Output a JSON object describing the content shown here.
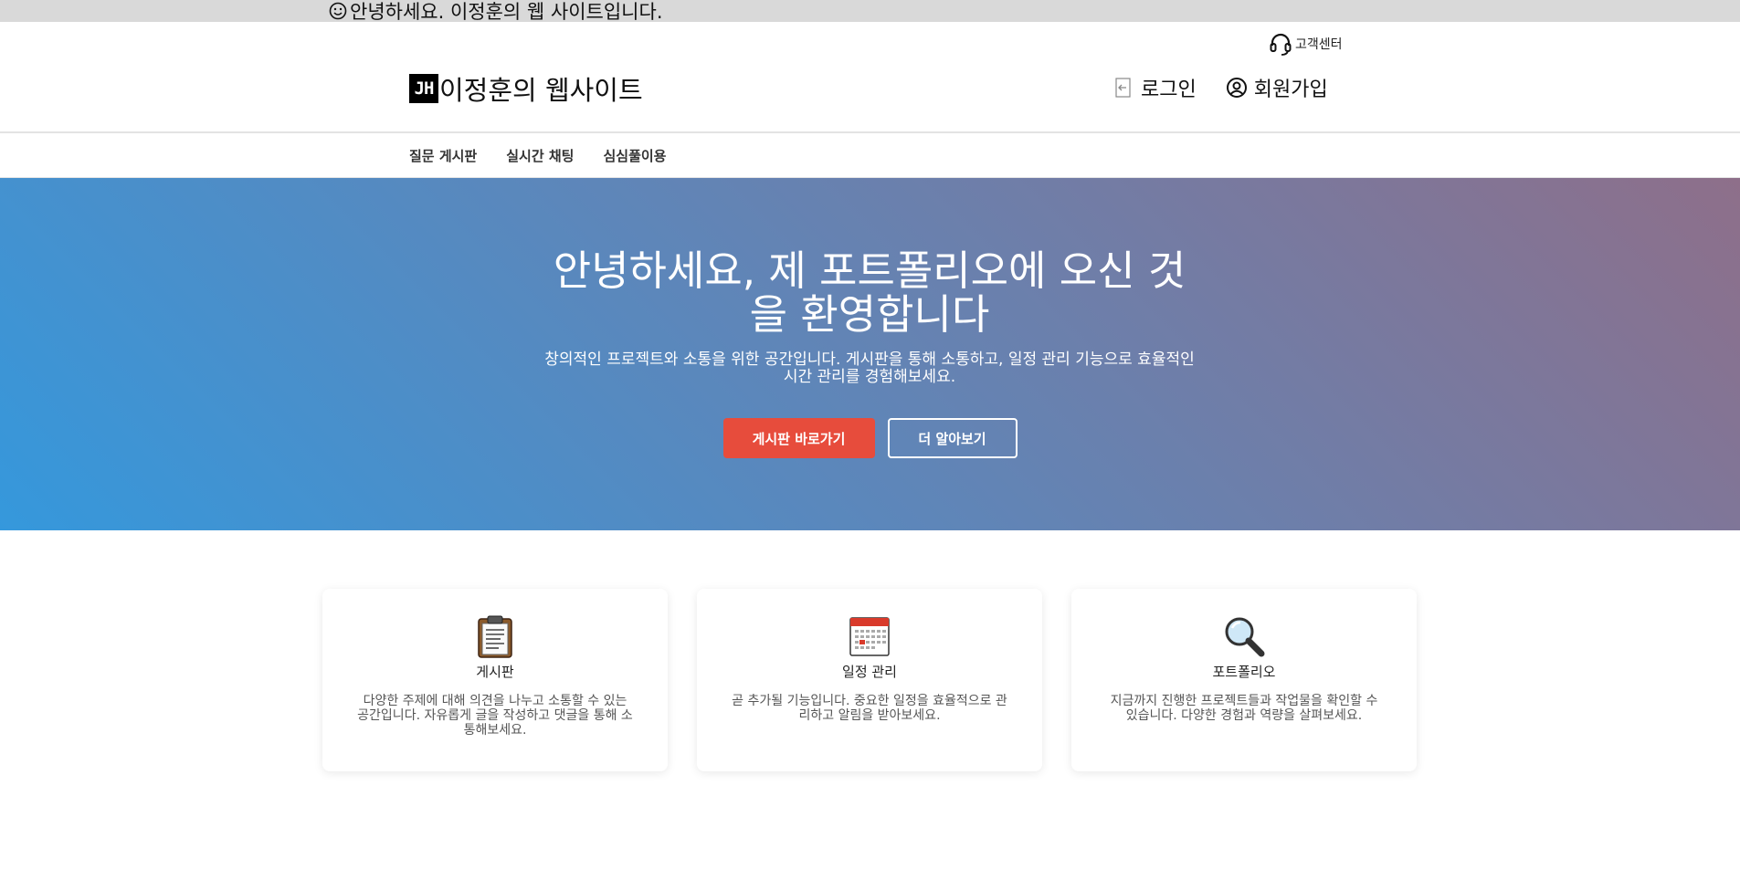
{
  "topbar": {
    "message": "안녕하세요. 이정훈의 웹 사이트입니다.",
    "icon": "smiley-icon"
  },
  "header": {
    "help_label": "고객센터",
    "logo_mark": "JH",
    "logo_text": "이정훈의 웹사이트",
    "login_label": "로그인",
    "signup_label": "회원가입"
  },
  "nav": {
    "items": [
      {
        "label": "질문 게시판"
      },
      {
        "label": "실시간 채팅"
      },
      {
        "label": "심심풀이용"
      }
    ]
  },
  "hero": {
    "title": "안녕하세요, 제 포트폴리오에 오신 것을 환영합니다",
    "subtitle": "창의적인 프로젝트와 소통을 위한 공간입니다. 게시판을 통해 소통하고, 일정 관리 기능으로 효율적인 시간 관리를 경험해보세요.",
    "primary_button": "게시판 바로가기",
    "secondary_button": "더 알아보기",
    "accent_color": "#e74c3c"
  },
  "features": [
    {
      "icon": "clipboard-icon",
      "title": "게시판",
      "description": "다양한 주제에 대해 의견을 나누고 소통할 수 있는 공간입니다. 자유롭게 글을 작성하고 댓글을 통해 소통해보세요."
    },
    {
      "icon": "calendar-icon",
      "title": "일정 관리",
      "description": "곧 추가될 기능입니다. 중요한 일정을 효율적으로 관리하고 알림을 받아보세요."
    },
    {
      "icon": "magnifier-icon",
      "title": "포트폴리오",
      "description": "지금까지 진행한 프로젝트들과 작업물을 확인할 수 있습니다. 다양한 경험과 역량을 살펴보세요."
    }
  ]
}
